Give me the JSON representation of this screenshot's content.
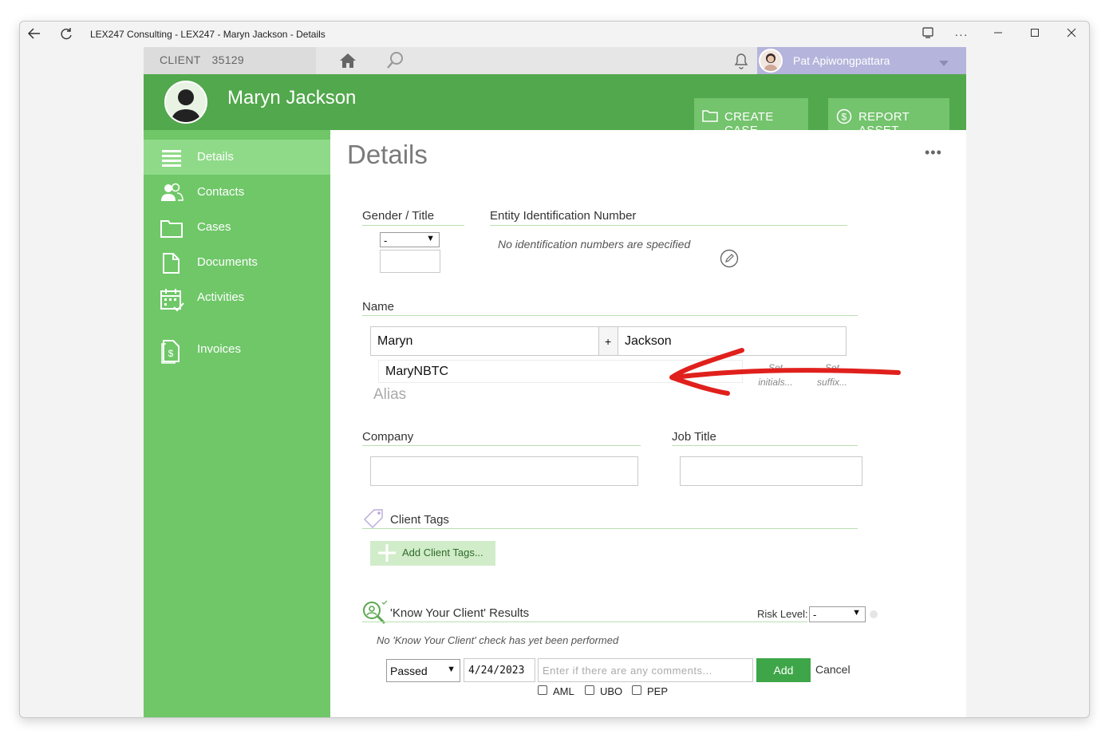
{
  "window": {
    "title": "LEX247 Consulting - LEX247 - Maryn Jackson - Details"
  },
  "topbar": {
    "client_label": "CLIENT",
    "client_number": "35129",
    "user_name": "Pat Apiwongpattara"
  },
  "header": {
    "client_name": "Maryn Jackson",
    "create_case": "CREATE CASE",
    "report_asset": "REPORT ASSET"
  },
  "sidebar": {
    "items": [
      {
        "label": "Details"
      },
      {
        "label": "Contacts"
      },
      {
        "label": "Cases"
      },
      {
        "label": "Documents"
      },
      {
        "label": "Activities"
      },
      {
        "label": "Invoices"
      }
    ]
  },
  "details": {
    "title": "Details",
    "more": "•••",
    "gender_title_label": "Gender / Title",
    "gender_value": "-",
    "title_value": "",
    "entity_id_label": "Entity Identification Number",
    "entity_id_note": "No identification numbers are specified",
    "name_label": "Name",
    "first_name": "Maryn",
    "name_plus": "+",
    "last_name": "Jackson",
    "alias_value": "MaryNBTC",
    "alias_label": "Alias",
    "set_initials": "Set initials...",
    "set_suffix": "Set suffix...",
    "company_label": "Company",
    "company_value": "",
    "job_title_label": "Job Title",
    "job_title_value": "",
    "client_tags_label": "Client Tags",
    "add_client_tags": "Add Client Tags...",
    "kyc_label": "'Know Your Client' Results",
    "risk_level_label": "Risk Level:",
    "risk_level_value": "-",
    "kyc_note": "No 'Know Your Client' check has yet been performed",
    "kyc_status": "Passed",
    "kyc_date": "4/24/2023",
    "kyc_comment_placeholder": "Enter if there are any comments...",
    "add_button": "Add",
    "cancel_button": "Cancel",
    "aml_label": "AML",
    "ubo_label": "UBO",
    "pep_label": "PEP"
  },
  "colors": {
    "header_green": "#52a84c",
    "sidebar_green": "#6fc768",
    "active_nav": "#8fda88",
    "user_bar": "#b4b4dc",
    "annotation_arrow": "#e0201c"
  }
}
